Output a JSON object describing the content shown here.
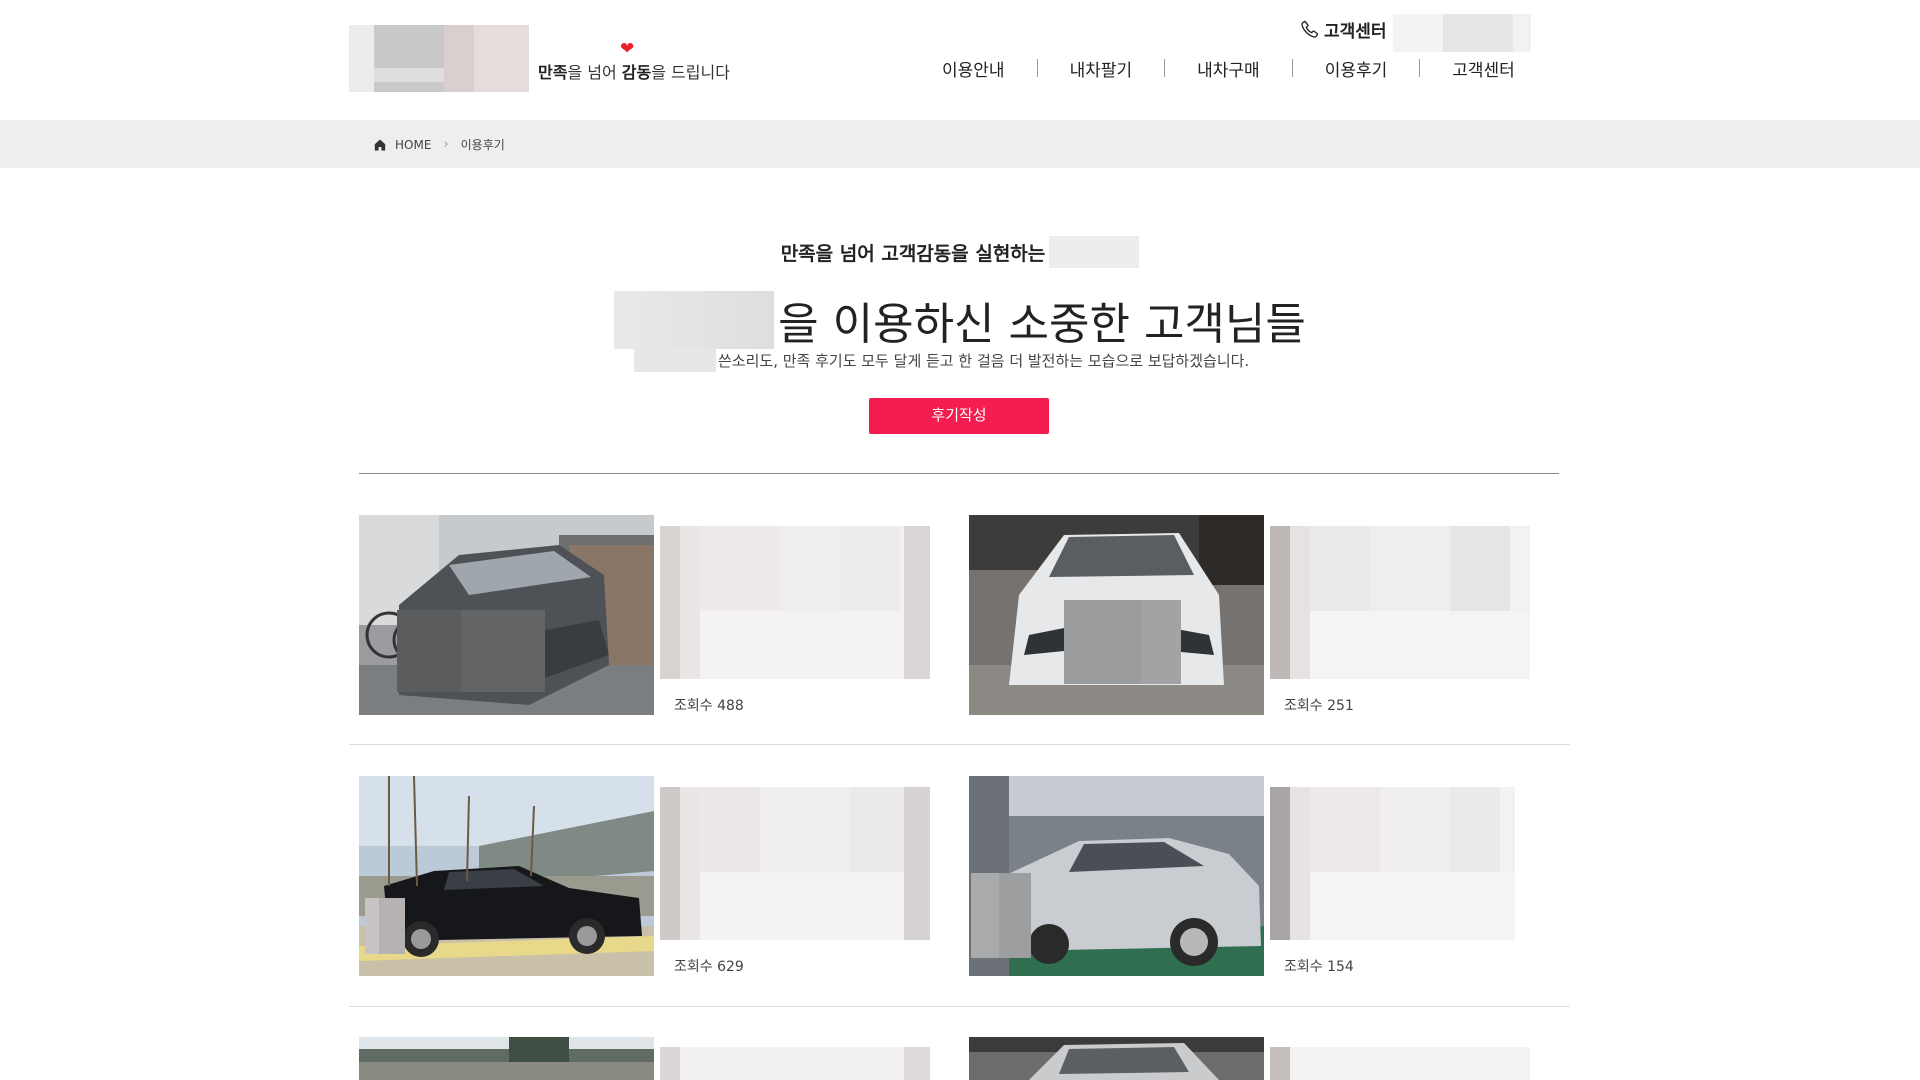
{
  "header": {
    "slogan_part1": "만족",
    "slogan_part2": "을 넘어 ",
    "slogan_part3": "감동",
    "slogan_part4": "을 드립니다",
    "phone_label": "고객센터"
  },
  "nav": {
    "items": [
      {
        "label": "이용안내"
      },
      {
        "label": "내차팔기"
      },
      {
        "label": "내차구매"
      },
      {
        "label": "이용후기"
      },
      {
        "label": "고객센터"
      }
    ]
  },
  "breadcrumb": {
    "home": "HOME",
    "current": "이용후기"
  },
  "intro": {
    "subtitle": "만족을 넘어 고객감동을 실현하는",
    "title": "을 이용하신 소중한 고객님들",
    "description": "쓴소리도, 만족 후기도 모두 달게 듣고 한 걸음 더 발전하는 모습으로 보답하겠습니다.",
    "write_button": "후기작성"
  },
  "reviews": [
    {
      "views": "조회수 488",
      "photo": "gray-suv"
    },
    {
      "views": "조회수 251",
      "photo": "white-sedan-front"
    },
    {
      "views": "조회수 629",
      "photo": "black-sedan"
    },
    {
      "views": "조회수 154",
      "photo": "silver-sedan-garage"
    }
  ],
  "colors": {
    "accent": "#f41d4f",
    "breadcrumb_bg": "#eeeeee",
    "heart": "#e8232d"
  }
}
